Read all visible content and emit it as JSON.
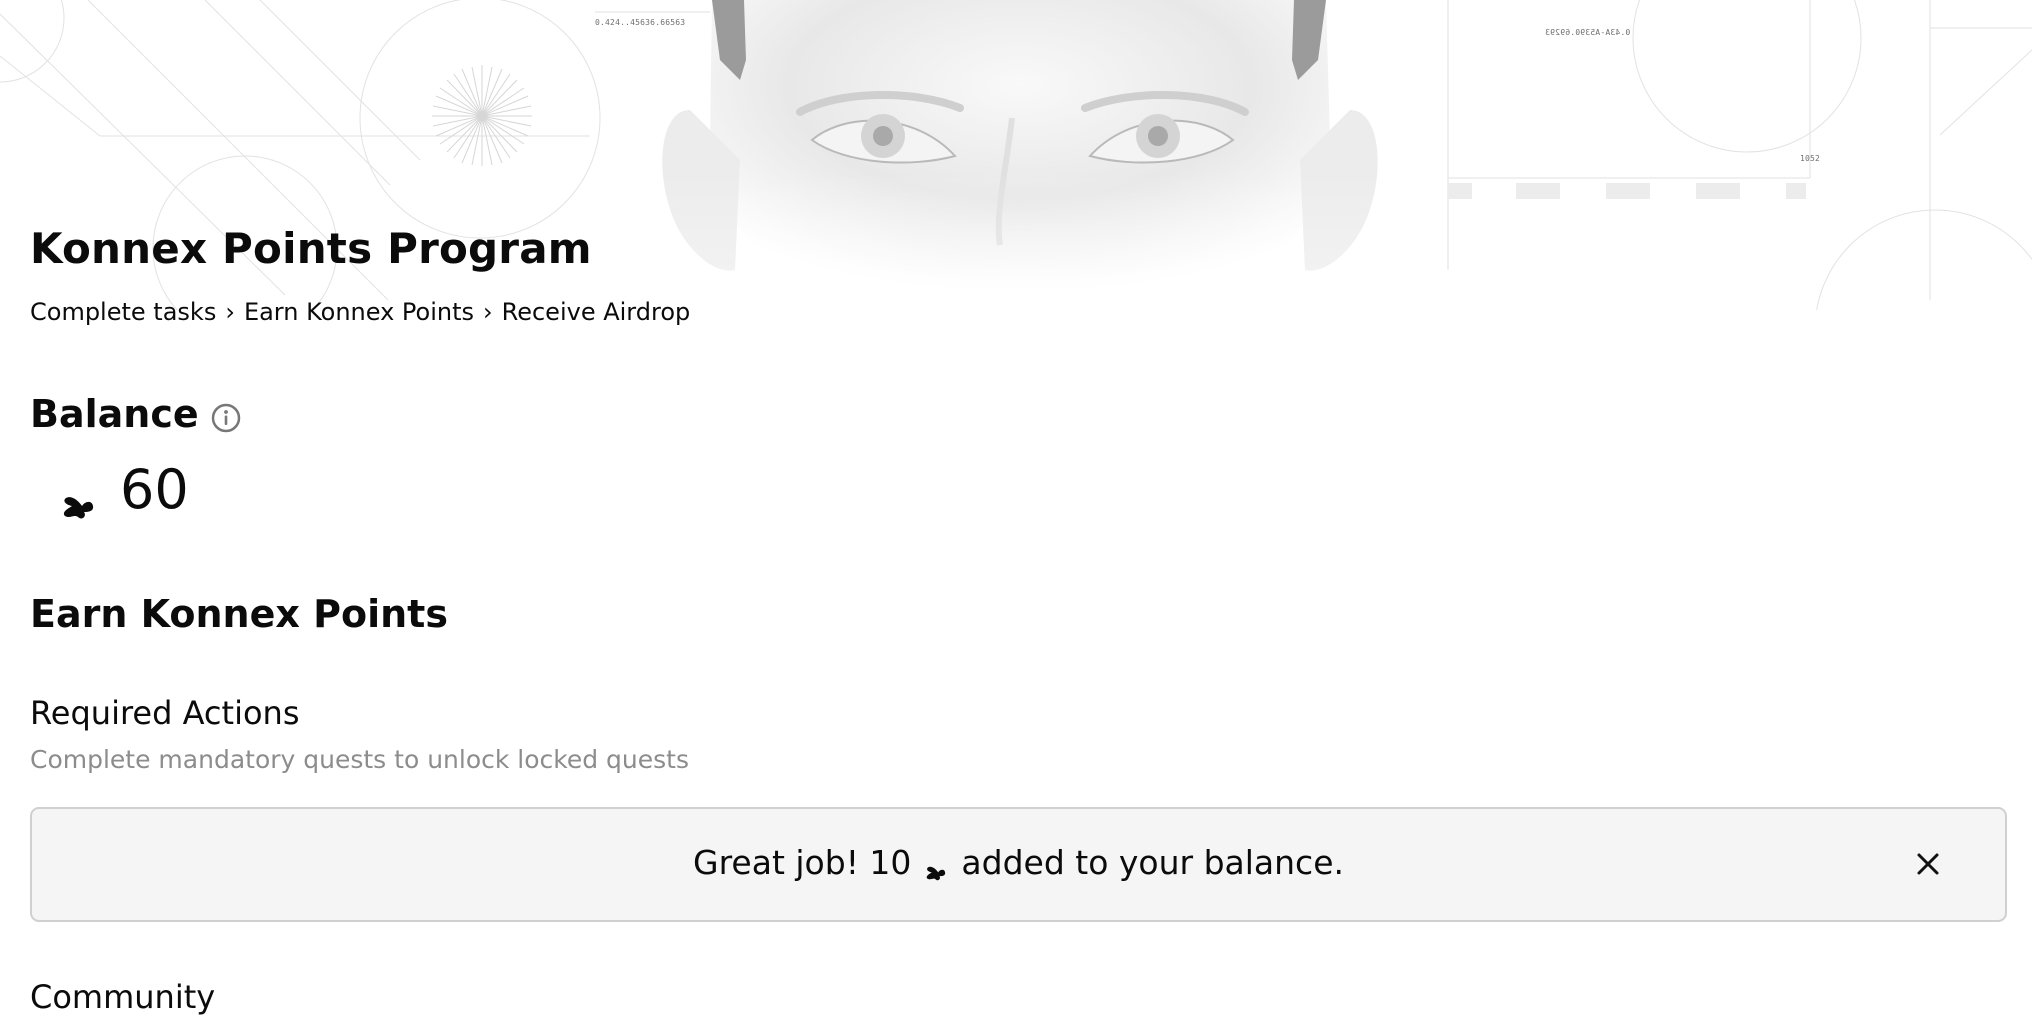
{
  "program": {
    "title": "Konnex Points Program",
    "breadcrumb": [
      "Complete tasks",
      "Earn Konnex Points",
      "Receive Airdrop"
    ],
    "breadcrumb_separator": "›"
  },
  "hero": {
    "readouts": {
      "left": "0.424..45636.66563",
      "right": "0.43A-A5390.69293",
      "small": "1052"
    }
  },
  "balance": {
    "heading": "Balance",
    "value": "60",
    "icon": "konnex-points-icon",
    "info_icon": "info-circle-icon"
  },
  "earn": {
    "title": "Earn Konnex Points"
  },
  "required_actions": {
    "title": "Required Actions",
    "description": "Complete mandatory quests to unlock locked quests"
  },
  "toast": {
    "prefix": "Great job! 10",
    "suffix": "added to your balance.",
    "close_icon": "close-icon"
  },
  "next_section": {
    "title": "Community"
  },
  "colors": {
    "background": "#ffffff",
    "text": "#0b0b0b",
    "muted_text": "#8c8c8c",
    "toast_background": "#f5f5f5",
    "toast_border": "#d0d0d0"
  }
}
